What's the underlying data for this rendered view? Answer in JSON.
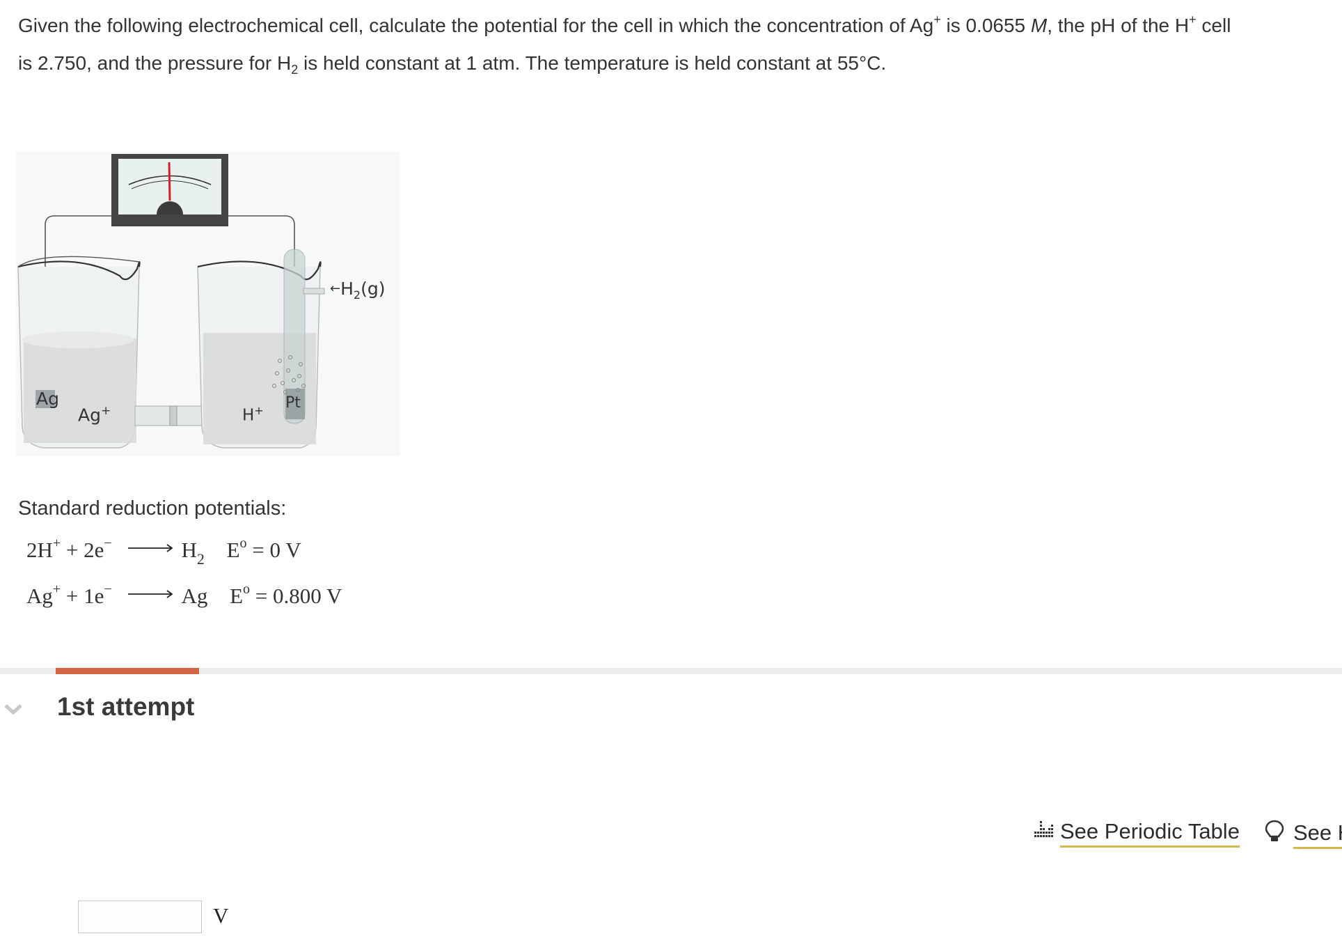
{
  "question": {
    "line1_part1": "Given the following electrochemical cell, calculate the potential for the cell in which the concentration of Ag",
    "sup_plus": "+",
    "line1_part2": " is 0.0655 ",
    "molar_unit": "M",
    "line1_part3": ", the pH of the H",
    "line1_part4": " cell",
    "line2_part1": "is 2.750, and the pressure for H",
    "sub_two": "2",
    "line2_part2": " is held constant at 1 atm. The temperature is held constant at 55°C."
  },
  "diagram": {
    "label_ag_electrode": "Ag",
    "label_ag_ion": "Ag",
    "label_ag_ion_charge": "+",
    "label_h_ion": "H",
    "label_h_ion_charge": "+",
    "label_pt_electrode": "Pt",
    "label_h2_gas_prefix": "←",
    "label_h2_gas": "H",
    "label_h2_sub": "2",
    "label_h2_state": "(g)",
    "colors": {
      "meter_body": "#444444",
      "meter_needle": "#d0202a",
      "meter_face": "#e9f1f0",
      "solution": "#d9dcdc",
      "glass": "#eef2f2"
    }
  },
  "potentials": {
    "title": "Standard reduction potentials:",
    "reactions": [
      {
        "reactant": "2H",
        "reactant_charge": "+",
        "plus": " + 2e",
        "electron_charge": "−",
        "product": "H",
        "product_sub": "2",
        "e_label": "E",
        "e_sup": "o",
        "e_value": " = 0 V"
      },
      {
        "reactant": "Ag",
        "reactant_charge": "+",
        "plus": " + 1e",
        "electron_charge": "−",
        "product": "Ag",
        "product_sub": "",
        "e_label": "E",
        "e_sup": "o",
        "e_value": " = 0.800 V"
      }
    ]
  },
  "progress": {
    "fill_fraction_of_tab": 1,
    "accent_color": "#d36544",
    "track_color": "#ececec"
  },
  "attempt": {
    "label": "1st attempt",
    "expand_icon": "chevron-down-icon"
  },
  "tools": {
    "periodic_table_label": "See Periodic Table",
    "periodic_table_icon": "periodic-table-icon",
    "hint_label": "See Hint",
    "hint_icon": "lightbulb-icon",
    "underline_color": "#d4b84a"
  },
  "answer": {
    "value": "",
    "placeholder": "",
    "unit": "V"
  }
}
